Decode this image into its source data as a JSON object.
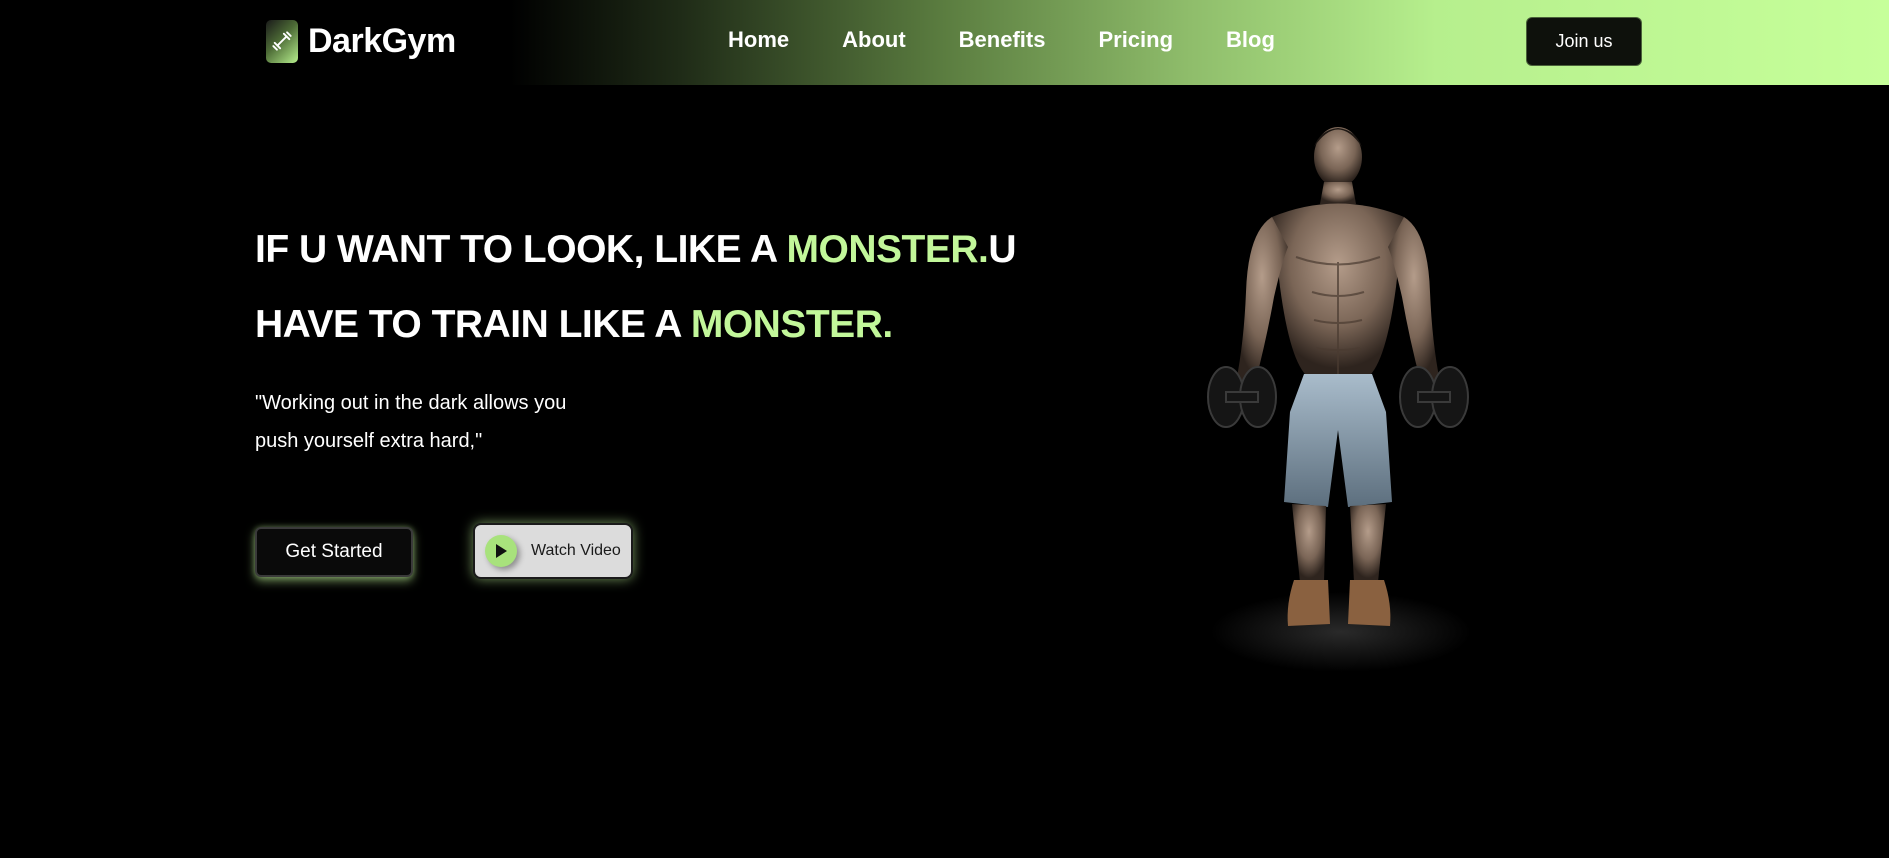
{
  "brand": {
    "name": "DarkGym",
    "logo_icon": "dumbbell-icon"
  },
  "nav": {
    "items": [
      {
        "label": "Home"
      },
      {
        "label": "About"
      },
      {
        "label": "Benefits"
      },
      {
        "label": "Pricing"
      },
      {
        "label": "Blog"
      }
    ],
    "cta_label": "Join us"
  },
  "hero": {
    "headline_line1_a": "IF U WANT TO LOOK, LIKE A ",
    "headline_line1_accent": "MONSTER.",
    "headline_line1_b": "U",
    "headline_line2_a": "HAVE TO TRAIN LIKE A ",
    "headline_line2_accent": "MONSTER.",
    "quote_line1": "\"Working out in the dark allows you",
    "quote_line2": "push yourself extra hard,\"",
    "primary_button": "Get Started",
    "secondary_button": "Watch Video",
    "secondary_icon": "play-icon",
    "image": "bodybuilder-with-dumbbells"
  },
  "colors": {
    "accent": "#c2f79a",
    "background": "#000000",
    "header_gradient_end": "#c6ff9a"
  }
}
